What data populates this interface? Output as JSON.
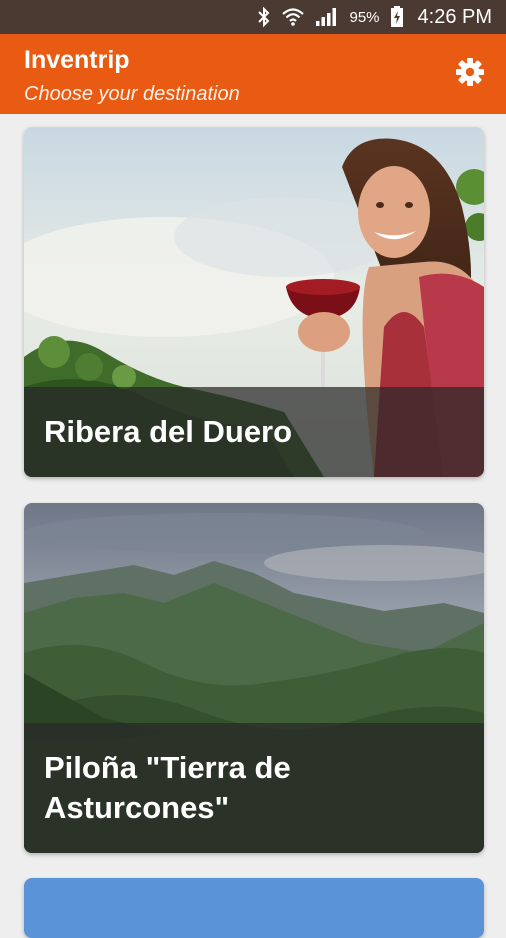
{
  "status_bar": {
    "battery_percent": "95%",
    "time": "4:26 PM",
    "icons": [
      "bluetooth-icon",
      "wifi-icon",
      "signal-icon",
      "battery-charging-icon"
    ]
  },
  "app_bar": {
    "title": "Inventrip",
    "subtitle": "Choose your destination",
    "settings_icon": "gear-icon",
    "color": "#e95a12"
  },
  "destinations": [
    {
      "name": "Ribera del Duero"
    },
    {
      "name": "Piloña \"Tierra de Asturcones\""
    }
  ]
}
